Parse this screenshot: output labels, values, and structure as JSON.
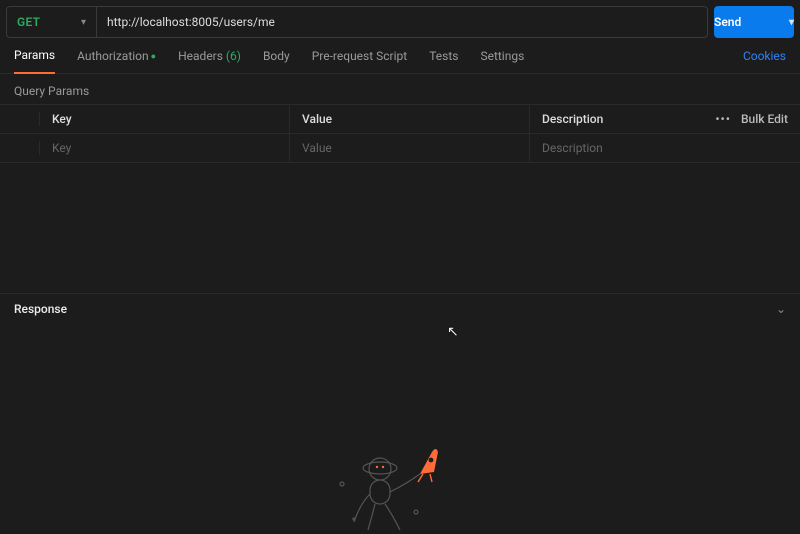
{
  "request": {
    "method": "GET",
    "url": "http://localhost:8005/users/me",
    "send_label": "Send"
  },
  "tabs": {
    "params": "Params",
    "auth": "Authorization",
    "headers_label": "Headers",
    "headers_count": "(6)",
    "body": "Body",
    "prereq": "Pre-request Script",
    "tests": "Tests",
    "settings": "Settings",
    "cookies": "Cookies"
  },
  "query_params": {
    "section": "Query Params",
    "head_key": "Key",
    "head_value": "Value",
    "head_desc": "Description",
    "bulk": "Bulk Edit",
    "ph_key": "Key",
    "ph_value": "Value",
    "ph_desc": "Description"
  },
  "response": {
    "label": "Response"
  },
  "colors": {
    "method": "#27ae60",
    "accent": "#ff6c37",
    "primary": "#097bed",
    "link": "#2f81f7"
  }
}
